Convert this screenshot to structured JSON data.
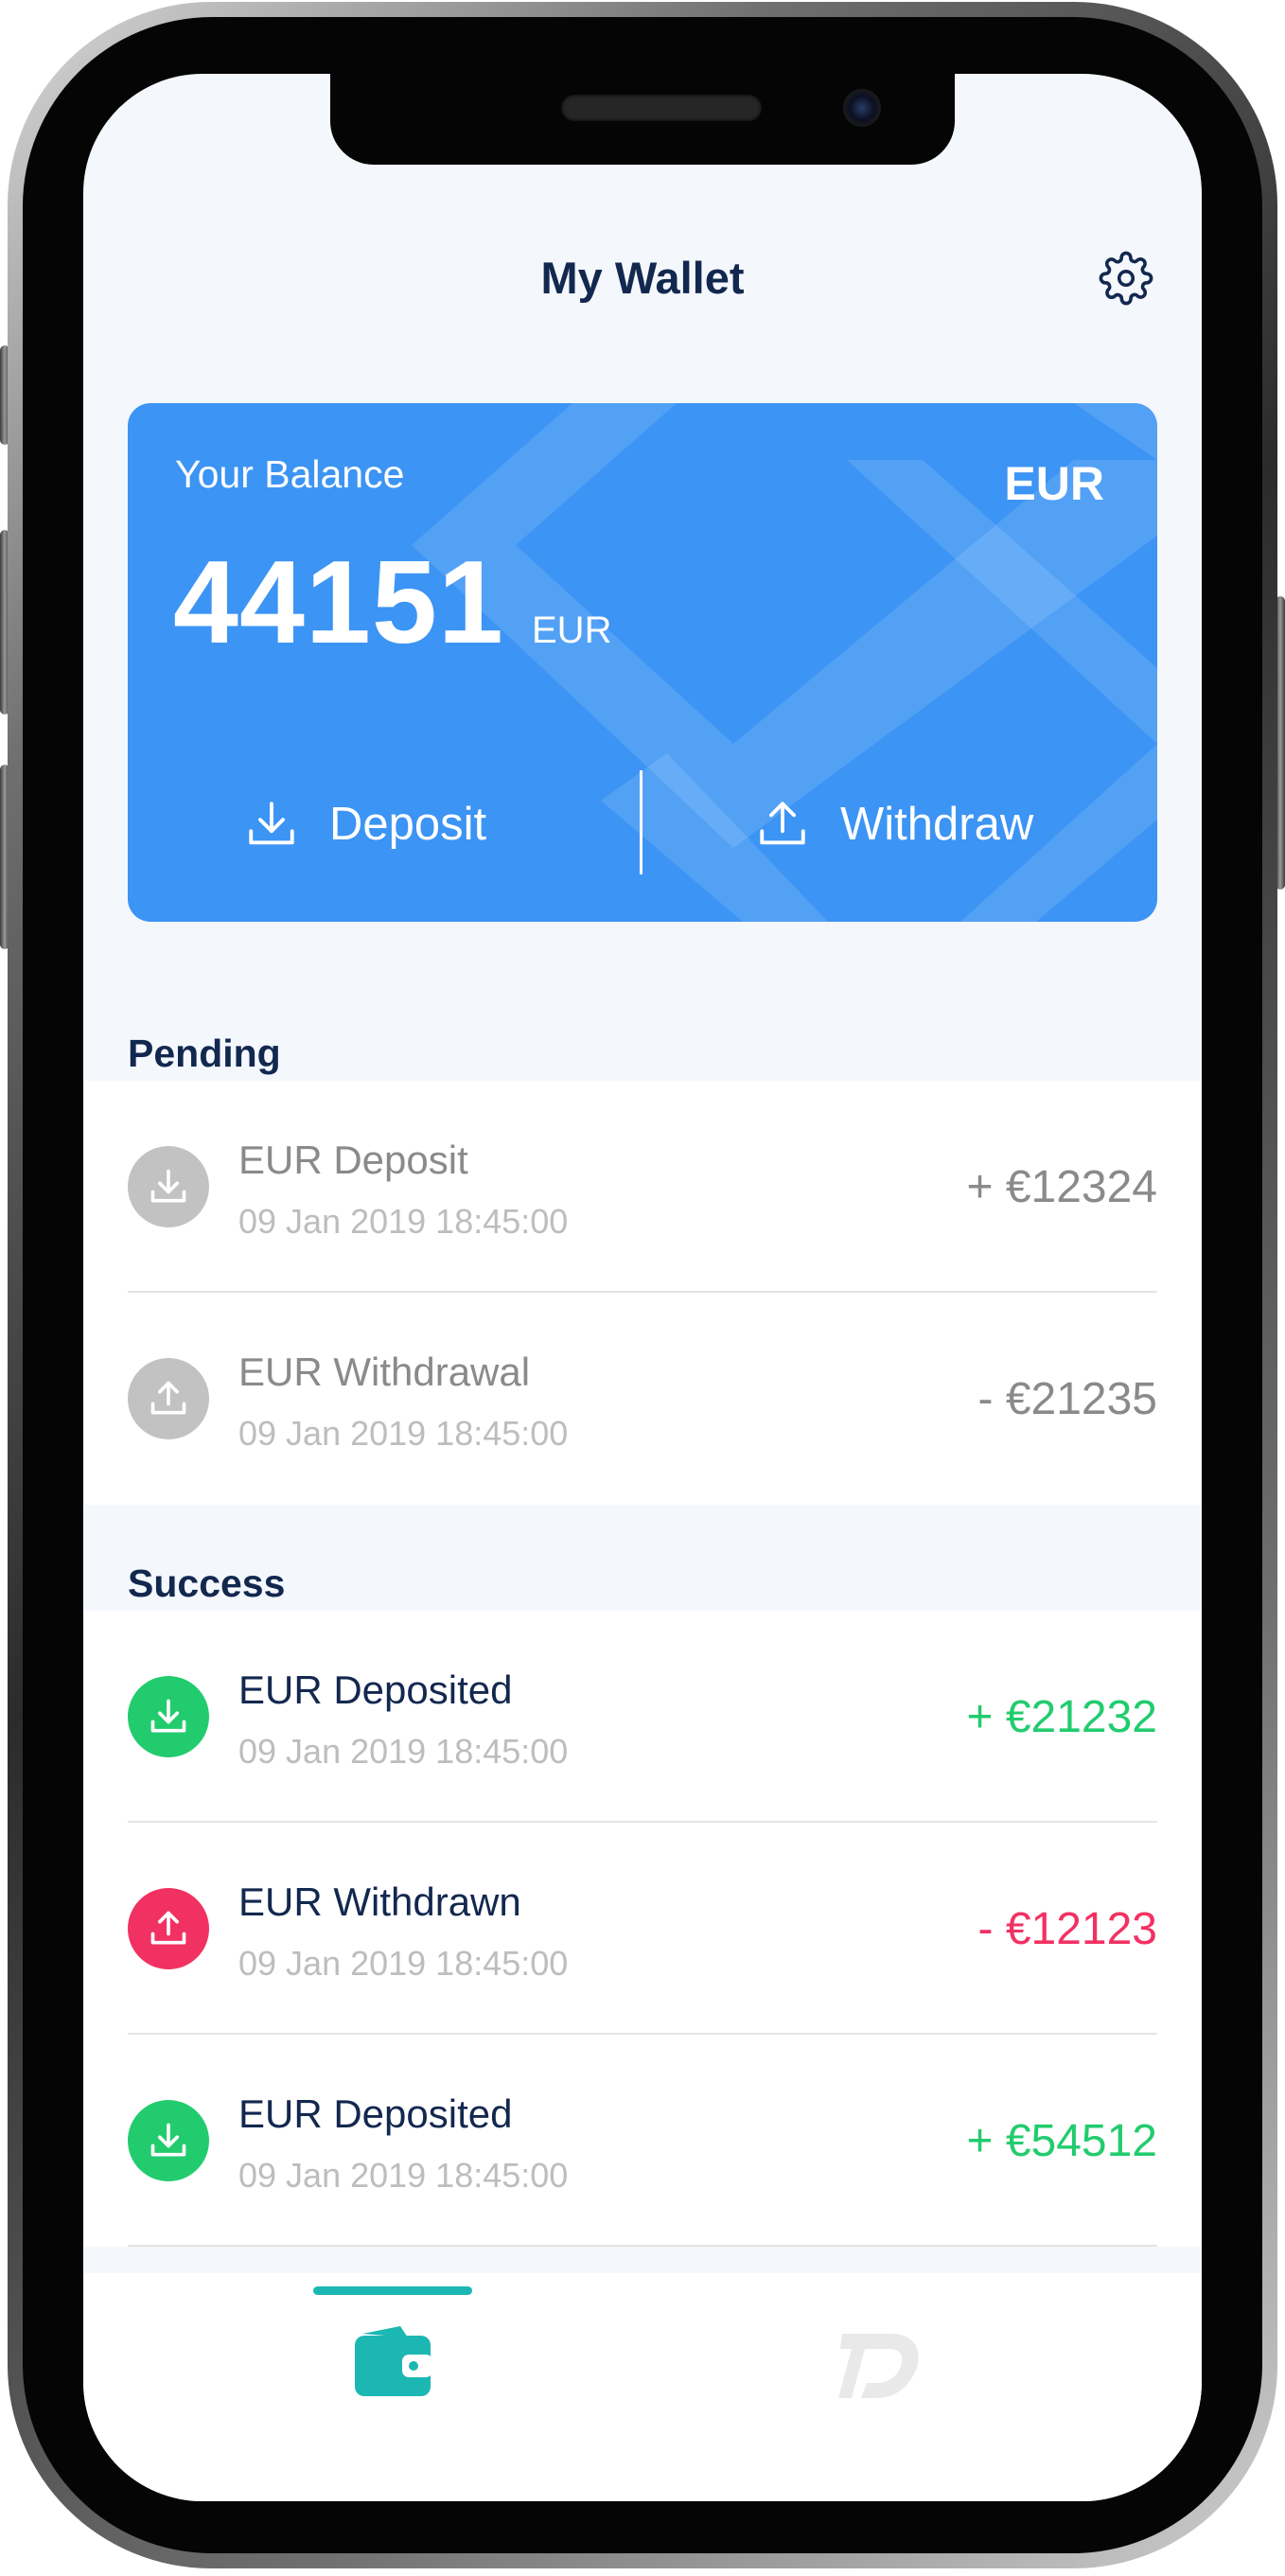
{
  "header": {
    "title": "My Wallet",
    "settings_icon": "gear-icon"
  },
  "balance_card": {
    "label": "Your Balance",
    "currency": "EUR",
    "amount": "44151",
    "amount_unit": "EUR",
    "deposit_label": "Deposit",
    "withdraw_label": "Withdraw",
    "deposit_icon": "download-icon",
    "withdraw_icon": "upload-icon",
    "color": "#3c94f4"
  },
  "pending": {
    "heading": "Pending",
    "items": [
      {
        "title": "EUR Deposit",
        "date": "09 Jan 2019 18:45:00",
        "amount": "+ €12324",
        "icon": "download-icon"
      },
      {
        "title": "EUR Withdrawal",
        "date": "09 Jan 2019 18:45:00",
        "amount": "- €21235",
        "icon": "upload-icon"
      }
    ],
    "color": "#8a8a8a"
  },
  "success": {
    "heading": "Success",
    "items": [
      {
        "title": "EUR Deposited",
        "date": "09 Jan 2019 18:45:00",
        "amount": "+ €21232",
        "icon": "download-icon",
        "status": "deposit"
      },
      {
        "title": "EUR Withdrawn",
        "date": "09 Jan 2019 18:45:00",
        "amount": "- €12123",
        "icon": "upload-icon",
        "status": "withdraw"
      },
      {
        "title": "EUR Deposited",
        "date": "09 Jan 2019 18:45:00",
        "amount": "+ €54512",
        "icon": "download-icon",
        "status": "deposit"
      }
    ],
    "deposit_color": "#22cc6e",
    "withdraw_color": "#f23163",
    "title_color": "#13284f"
  },
  "bottom_nav": {
    "items": [
      {
        "icon": "wallet-icon",
        "active": true
      },
      {
        "icon": "td-logo-icon",
        "active": false
      }
    ],
    "active_color": "#1cb7b2"
  }
}
